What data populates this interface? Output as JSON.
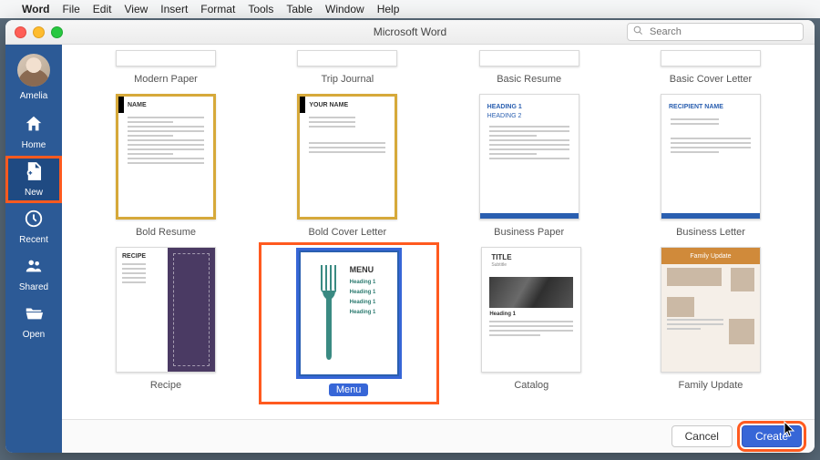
{
  "menubar": {
    "apple": "",
    "app": "Word",
    "items": [
      "File",
      "Edit",
      "View",
      "Insert",
      "Format",
      "Tools",
      "Table",
      "Window",
      "Help"
    ]
  },
  "window": {
    "title": "Microsoft Word",
    "search_placeholder": "Search"
  },
  "sidebar": {
    "user": "Amelia",
    "items": [
      {
        "id": "home",
        "label": "Home"
      },
      {
        "id": "new",
        "label": "New"
      },
      {
        "id": "recent",
        "label": "Recent"
      },
      {
        "id": "shared",
        "label": "Shared"
      },
      {
        "id": "open",
        "label": "Open"
      }
    ]
  },
  "templates": {
    "row0": [
      "Modern Paper",
      "Trip Journal",
      "Basic Resume",
      "Basic Cover Letter"
    ],
    "row1": [
      "Bold Resume",
      "Bold Cover Letter",
      "Business Paper",
      "Business Letter"
    ],
    "row2": [
      "Recipe",
      "Menu",
      "Catalog",
      "Family Update"
    ]
  },
  "thumb": {
    "name": "NAME",
    "yourname": "YOUR NAME",
    "heading1": "HEADING 1",
    "heading2": "HEADING 2",
    "recipient": "RECIPIENT NAME",
    "recipe": "RECIPE",
    "menu_title": "MENU",
    "menu_h": "Heading 1",
    "cat_title": "TITLE",
    "cat_sub": "Subtitle",
    "cat_head": "Heading 1",
    "fam_title": "Family Update"
  },
  "footer": {
    "cancel": "Cancel",
    "create": "Create"
  }
}
